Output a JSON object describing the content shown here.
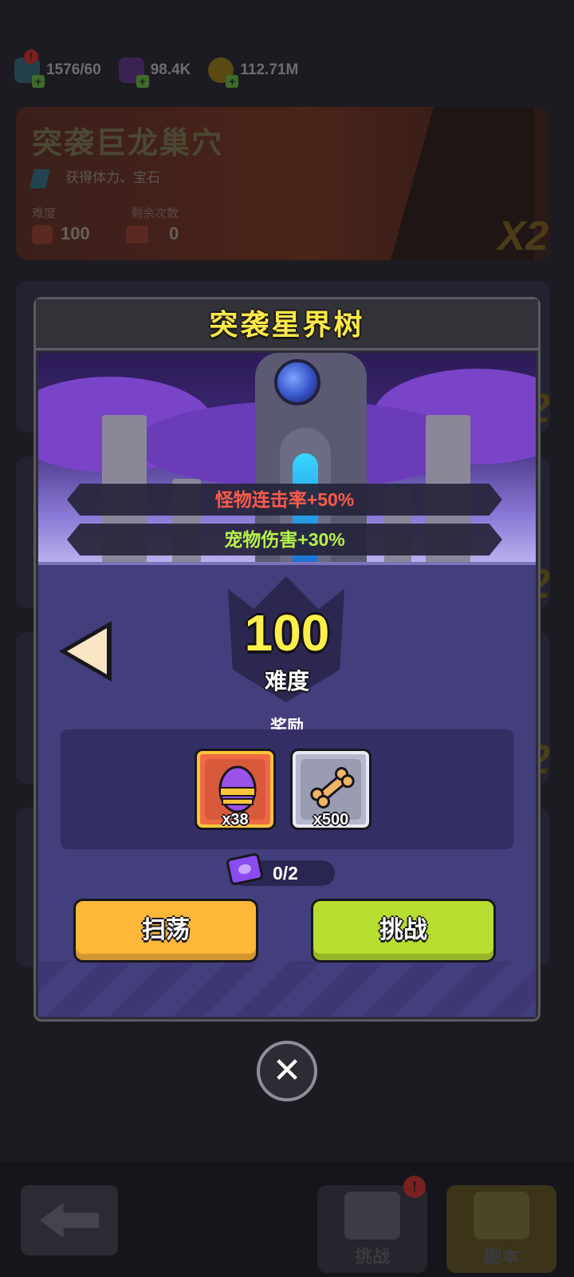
{
  "background": {
    "resources": [
      {
        "icon": "energy-icon",
        "value": "1576/60"
      },
      {
        "icon": "gem-icon",
        "value": "98.4K"
      },
      {
        "icon": "coin-icon",
        "value": "112.71M"
      }
    ],
    "event_card": {
      "title": "突袭巨龙巢穴",
      "subtitle": "获得体力、宝石",
      "difficulty_label": "难度",
      "difficulty_value": "100",
      "remaining_label": "剩余次数",
      "remaining_value": "0",
      "multiplier": "X2"
    },
    "card_multipliers": [
      "2",
      "2",
      "2"
    ],
    "nav": {
      "challenge_label": "挑战",
      "dungeon_label": "副本",
      "alert_badge": "!"
    }
  },
  "modal": {
    "title": "突袭星界树",
    "buffs": [
      "怪物连击率+50%",
      "宠物伤害+30%"
    ],
    "difficulty_value": "100",
    "difficulty_label": "难度",
    "reward_title": "奖励",
    "rewards": [
      {
        "icon": "pet-egg-icon",
        "count": "x38"
      },
      {
        "icon": "bone-icon",
        "count": "x500"
      }
    ],
    "tickets": "0/2",
    "sweep_label": "扫荡",
    "challenge_label": "挑战"
  },
  "colors": {
    "title_yellow": "#ffe84a",
    "buff_red": "#ff5c4a",
    "buff_green": "#b6f24a",
    "sweep_button": "#ffb73a",
    "challenge_button": "#b7dd30",
    "panel_purple": "#433e7c"
  }
}
